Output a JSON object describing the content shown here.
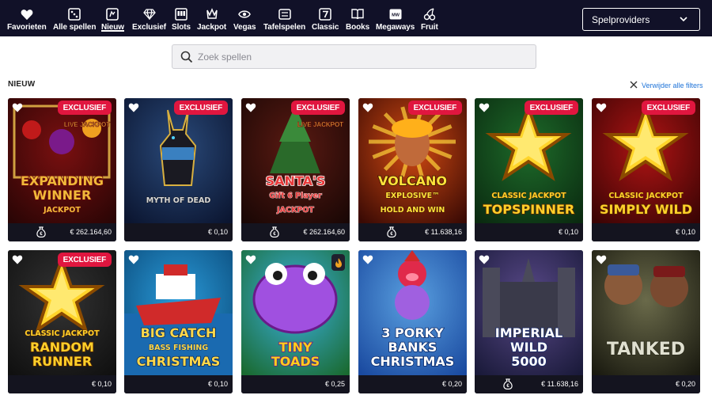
{
  "nav": {
    "categories": [
      {
        "label": "Favorieten",
        "icon": "heart-icon"
      },
      {
        "label": "Alle spellen",
        "icon": "dice-icon"
      },
      {
        "label": "Nieuw",
        "icon": "new-icon"
      },
      {
        "label": "Exclusief",
        "icon": "diamond-icon"
      },
      {
        "label": "Slots",
        "icon": "slot-machine-icon"
      },
      {
        "label": "Jackpot",
        "icon": "crown-icon"
      },
      {
        "label": "Vegas",
        "icon": "eye-icon"
      },
      {
        "label": "Tafelspelen",
        "icon": "table-icon"
      },
      {
        "label": "Classic",
        "icon": "seven-icon"
      },
      {
        "label": "Books",
        "icon": "book-icon"
      },
      {
        "label": "Megaways",
        "icon": "megaways-icon"
      },
      {
        "label": "Fruit",
        "icon": "cherry-icon"
      }
    ],
    "active": "Nieuw",
    "provider_label": "Spelproviders"
  },
  "search": {
    "placeholder": "Zoek spellen",
    "value": ""
  },
  "section": {
    "title": "NIEUW",
    "clear_label": "Verwijder alle filters"
  },
  "games": [
    {
      "title_lines": [
        "EXPANDING",
        "WINNER",
        "JACKPOT"
      ],
      "badge": "EXCLUSIEF",
      "top_text": "LIVE JACKPOT",
      "amount": "€ 262.164,60",
      "jackpot": true,
      "theme": "fruit"
    },
    {
      "title_lines": [
        "MYTH OF DEAD"
      ],
      "badge": "EXCLUSIEF",
      "top_text": "",
      "amount": "€ 0,10",
      "jackpot": false,
      "theme": "anubis"
    },
    {
      "title_lines": [
        "SANTA'S",
        "Gift 6 Player",
        "JACKPOT"
      ],
      "badge": "EXCLUSIEF",
      "top_text": "LIVE JACKPOT",
      "amount": "€ 262.164,60",
      "jackpot": true,
      "theme": "santa"
    },
    {
      "title_lines": [
        "VOLCANO",
        "EXPLOSIVE™",
        "HOLD AND WIN"
      ],
      "badge": "EXCLUSIEF",
      "top_text": "",
      "amount": "€ 11.638,16",
      "jackpot": true,
      "theme": "volcano"
    },
    {
      "title_lines": [
        "CLASSIC JACKPOT",
        "TOPSPINNER"
      ],
      "badge": "EXCLUSIEF",
      "top_text": "",
      "amount": "€ 0,10",
      "jackpot": false,
      "theme": "star-green"
    },
    {
      "title_lines": [
        "CLASSIC JACKPOT",
        "SIMPLY WILD"
      ],
      "badge": "EXCLUSIEF",
      "top_text": "",
      "amount": "€ 0,10",
      "jackpot": false,
      "theme": "star-red"
    },
    {
      "title_lines": [
        "CLASSIC JACKPOT",
        "RANDOM",
        "RUNNER"
      ],
      "badge": "EXCLUSIEF",
      "top_text": "",
      "amount": "€ 0,10",
      "jackpot": false,
      "theme": "star-dark"
    },
    {
      "title_lines": [
        "BIG CATCH",
        "BASS FISHING",
        "CHRISTMAS"
      ],
      "badge": "",
      "top_text": "",
      "amount": "€ 0,10",
      "jackpot": false,
      "theme": "boat"
    },
    {
      "title_lines": [
        "TINY",
        "TOADS"
      ],
      "badge": "",
      "top_text": "",
      "amount": "€ 0,25",
      "jackpot": false,
      "theme": "toad",
      "hot": true
    },
    {
      "title_lines": [
        "3 PORKY",
        "BANKS",
        "CHRISTMAS"
      ],
      "badge": "",
      "top_text": "",
      "amount": "€ 0,20",
      "jackpot": false,
      "theme": "pig"
    },
    {
      "title_lines": [
        "IMPERIAL",
        "WILD",
        "5000"
      ],
      "badge": "",
      "top_text": "",
      "amount": "€ 11.638,16",
      "jackpot": true,
      "theme": "castle"
    },
    {
      "title_lines": [
        "TANKED"
      ],
      "badge": "",
      "top_text": "",
      "amount": "€ 0,20",
      "jackpot": false,
      "theme": "tank"
    }
  ]
}
